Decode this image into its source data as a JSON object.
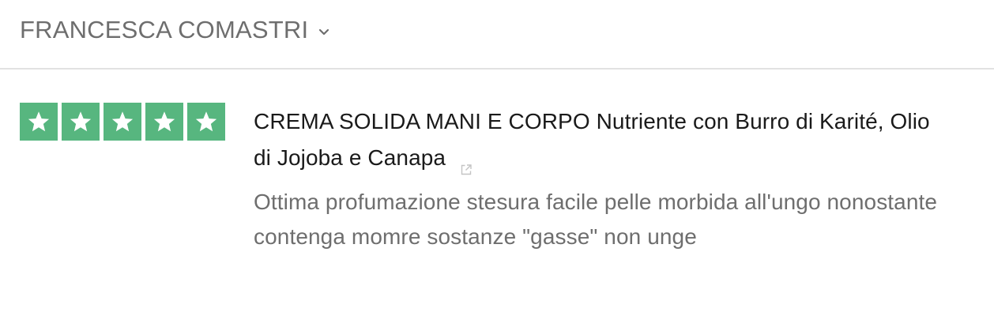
{
  "reviewer": {
    "name": "FRANCESCA COMASTRI",
    "dropdown_icon": "chevron-down-icon"
  },
  "review": {
    "rating": 5,
    "rating_max": 5,
    "star_color": "#57b67f",
    "product_title": "CREMA SOLIDA MANI E CORPO Nutriente con Burro di Karité, Olio di Jojoba e Canapa",
    "external_link_icon": "external-link-icon",
    "text": "Ottima profumazione stesura facile pelle morbida all'ungo nonostante contenga momre sostanze \"gasse\" non unge"
  }
}
